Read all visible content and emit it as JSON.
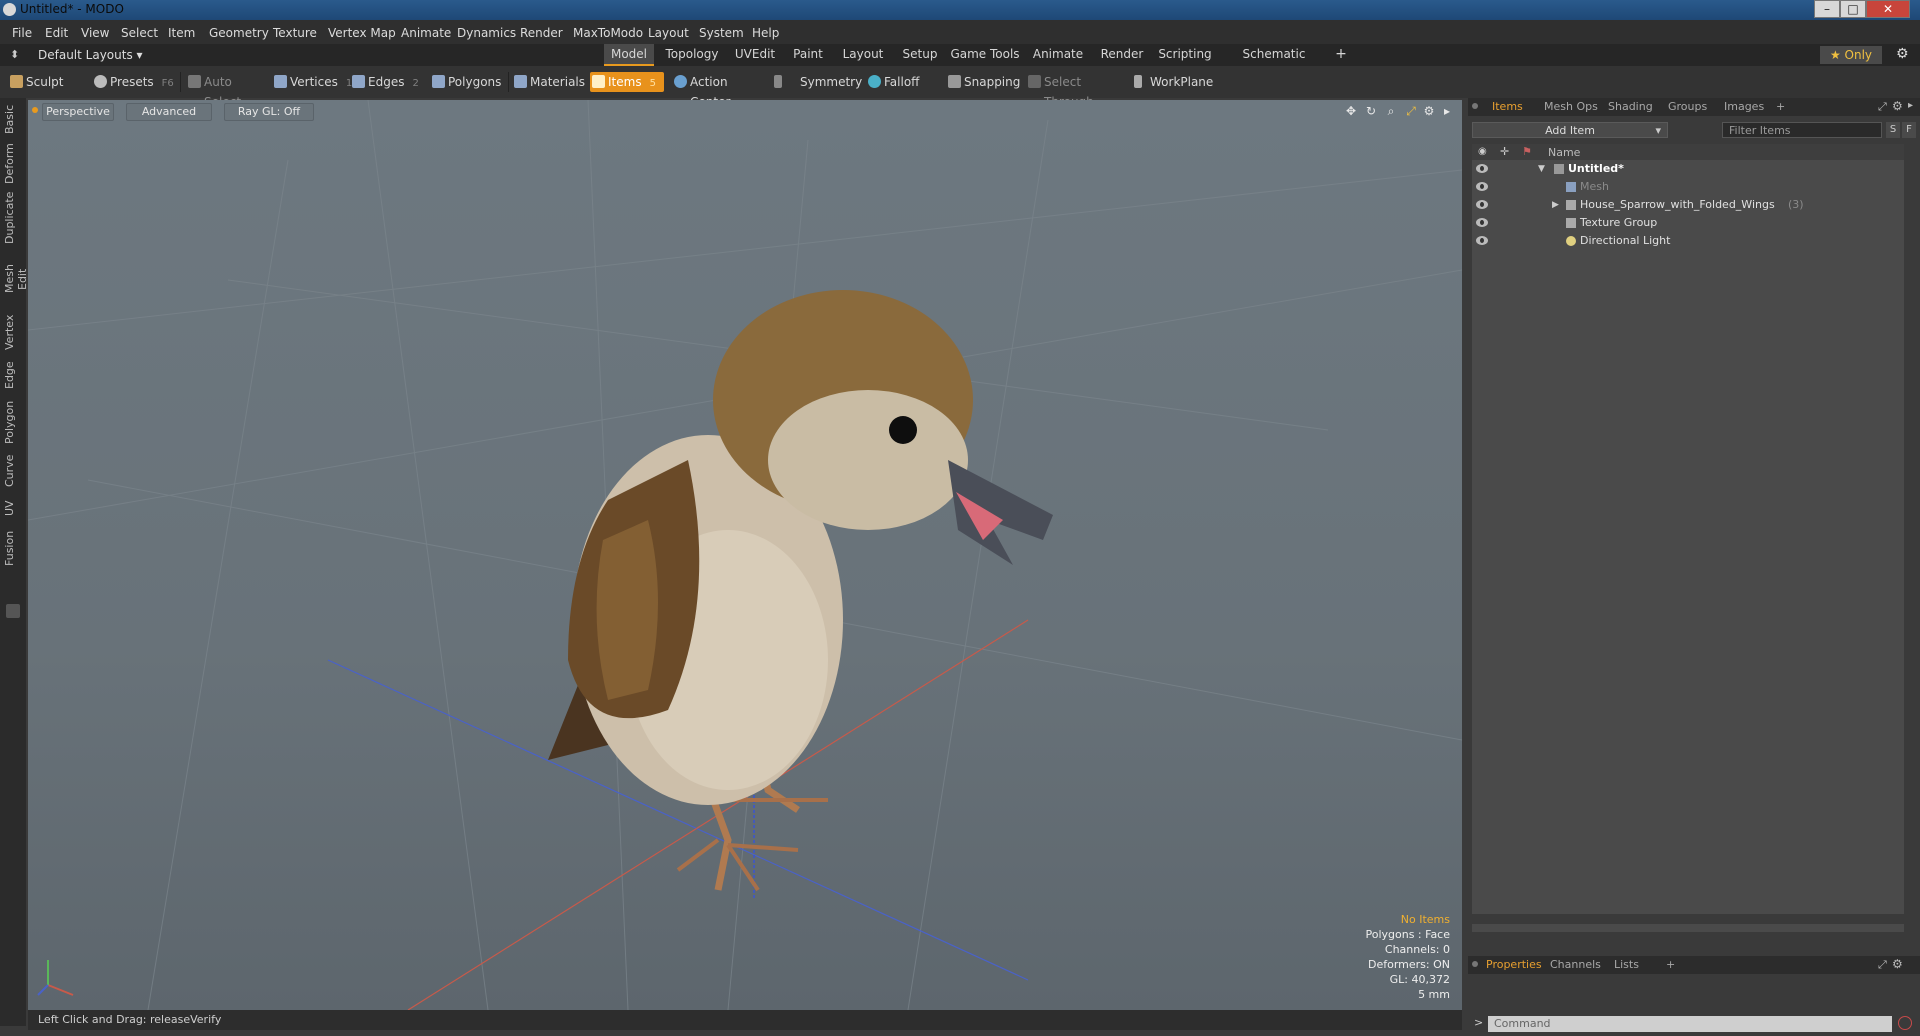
{
  "window": {
    "title": "Untitled* - MODO",
    "minimize": "–",
    "maximize": "□",
    "close": "✕"
  },
  "menu": [
    "File",
    "Edit",
    "View",
    "Select",
    "Item",
    "Geometry",
    "Texture",
    "Vertex Map",
    "Animate",
    "Dynamics",
    "Render",
    "MaxToModo",
    "Layout",
    "System",
    "Help"
  ],
  "layouts": {
    "label": "Default Layouts ▾",
    "only": "★  Only",
    "tabs": [
      "Model",
      "Topology",
      "UVEdit",
      "Paint",
      "Layout",
      "Setup",
      "Game Tools",
      "Animate",
      "Render",
      "Scripting",
      "Schematic Fusion",
      "+"
    ]
  },
  "toolbar": {
    "sculpt": "Sculpt",
    "presets": "Presets",
    "presets_key": "F6",
    "auto_select": "Auto Select",
    "vertices": "Vertices",
    "vertices_key": "1",
    "edges": "Edges",
    "edges_key": "2",
    "polygons": "Polygons",
    "materials": "Materials",
    "items": "Items",
    "items_key": "5",
    "action_center": "Action Center",
    "symmetry": "Symmetry",
    "falloff": "Falloff",
    "snapping": "Snapping",
    "select_through": "Select Through",
    "workplane": "WorkPlane"
  },
  "left_tabs": [
    "Basic",
    "Deform",
    "Duplicate",
    "Mesh Edit",
    "Vertex",
    "Edge",
    "Polygon",
    "Curve",
    "UV",
    "Fusion"
  ],
  "viewport": {
    "perspective": "Perspective",
    "advanced": "Advanced",
    "raygl": "Ray GL: Off",
    "info": {
      "no_items": "No Items",
      "polygons": "Polygons : Face",
      "channels": "Channels: 0",
      "deformers": "Deformers: ON",
      "gl": "GL: 40,372",
      "scale": "5 mm"
    }
  },
  "status": "Left Click and Drag:   releaseVerify",
  "panel": {
    "tabs": [
      "Items",
      "Mesh Ops",
      "Shading",
      "Groups",
      "Images",
      "+"
    ],
    "add_item": "Add Item",
    "filter": "Filter Items",
    "filter_s": "S",
    "filter_f": "F",
    "col_name": "Name",
    "items": [
      {
        "name": "Untitled*",
        "bold": true
      },
      {
        "name": "Mesh",
        "dim": true
      },
      {
        "name": "House_Sparrow_with_Folded_Wings",
        "count": "(3)"
      },
      {
        "name": "Texture Group"
      },
      {
        "name": "Directional Light"
      }
    ],
    "bottom_tabs": [
      "Properties",
      "Channels",
      "Lists",
      "+"
    ],
    "command_placeholder": "Command",
    "prompt": ">"
  }
}
